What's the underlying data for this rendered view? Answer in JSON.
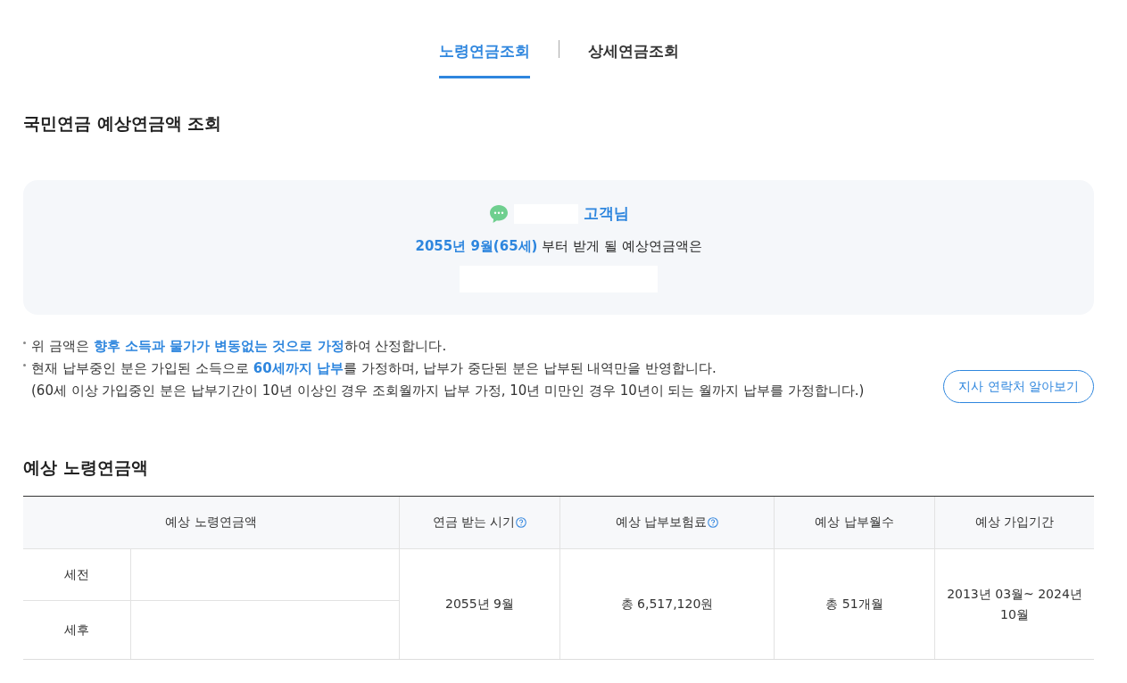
{
  "tabs": [
    {
      "label": "노령연금조회",
      "selected": true
    },
    {
      "label": "상세연금조회",
      "selected": false
    }
  ],
  "page_title": "국민연금 예상연금액 조회",
  "summary": {
    "greeting": "고객님",
    "message": "**2055년 9월(65세)** 부터 받게 될 예상연금액은"
  },
  "notes": [
    {
      "kind": "bullet",
      "text": "위 금액은 **향후 소득과 물가가 변동없는 것으로 가정**하여 산정합니다."
    },
    {
      "kind": "bullet",
      "text": "현재 납부중인 분은 가입된 소득으로 **60세까지 납부**를 가정하며, 납부가 중단된 분은 납부된 내역만을 반영합니다."
    },
    {
      "kind": "continuation",
      "text": "(60세 이상 가입중인 분은 납부기간이 10년 이상인 경우 조회월까지 납부 가정, 10년 미만인 경우 10년이 되는 월까지 납부를 가정합니다.)"
    }
  ],
  "branch_button": "지사 연락처 알아보기",
  "section_title": "예상 노령연금액",
  "table": {
    "columns": [
      {
        "label": "예상 노령연금액",
        "help": false
      },
      {
        "label": "연금 받는 시기",
        "help": true
      },
      {
        "label": "예상 납부보험료",
        "help": true
      },
      {
        "label": "예상 납부월수",
        "help": false
      },
      {
        "label": "예상 가입기간",
        "help": false
      }
    ],
    "row_labels": [
      "세전",
      "세후"
    ],
    "receive_date": "2055년 9월",
    "premium": "총 6,517,120원",
    "months": "총 51개월",
    "period": "2013년 03월~ 2024년 10월"
  }
}
